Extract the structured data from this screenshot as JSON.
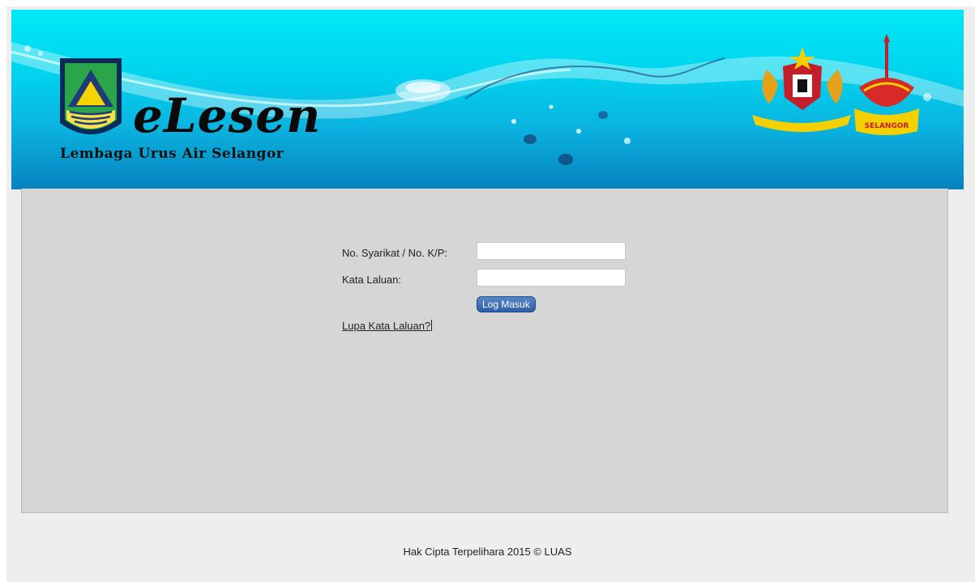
{
  "banner": {
    "title": "eLesen",
    "subtitle": "Lembaga Urus Air Selangor",
    "left_logo": "luas-logo",
    "right_emblems": [
      "malaysia-coat-of-arms",
      "selangor-state-crest"
    ],
    "crest_text": "SELANGOR",
    "colors": {
      "sky": "#00e0f4",
      "deep": "#0682bf"
    }
  },
  "login_form": {
    "company_label": "No. Syarikat / No. K/P:",
    "company_value": "",
    "password_label": "Kata Laluan:",
    "password_value": "",
    "submit_label": "Log Masuk",
    "forgot_link": "Lupa Kata Laluan?",
    "button_color": "#3565ad"
  },
  "footer": {
    "copyright": "Hak Cipta Terpelihara 2015 © LUAS"
  }
}
